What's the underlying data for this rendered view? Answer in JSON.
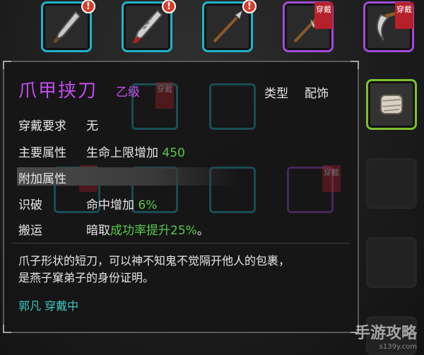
{
  "top_slots": [
    {
      "icon": "dagger-icon",
      "badge": "!"
    },
    {
      "icon": "serrated-blade-icon",
      "badge": "!"
    },
    {
      "icon": "spear-icon",
      "badge": "!"
    },
    {
      "icon": "halberd-icon",
      "tag": "穿戴"
    },
    {
      "icon": "sickle-icon",
      "tag": "穿戴"
    }
  ],
  "ghost_tags": [
    "穿戴",
    "穿戴",
    "穿戴"
  ],
  "side_slot": {
    "icon": "bandaged-fist-icon"
  },
  "item": {
    "name": "爪甲挟刀",
    "grade": "乙级",
    "type_label": "类型",
    "type_value": "配饰",
    "wear_req_label": "穿戴要求",
    "wear_req_value": "无",
    "main_attr_label": "主要属性",
    "main_attr_text": "生命上限增加",
    "main_attr_num": "450",
    "extra_attr_label": "附加属性",
    "extra1_label": "识破",
    "extra1_text": "命中增加",
    "extra1_num": "6%",
    "extra2_label": "搬运",
    "extra2_text_a": "暗取",
    "extra2_text_b": "成功率提升",
    "extra2_num": "25%",
    "extra2_tail": "。",
    "description_line1": "爪子形状的短刀，可以神不知鬼不觉隔开他人的包裹，",
    "description_line2": "是燕子窠弟子的身份证明。",
    "owner": "郭凡 穿戴中"
  },
  "watermark": {
    "main": "手游攻略",
    "sub": "s139y.com"
  }
}
